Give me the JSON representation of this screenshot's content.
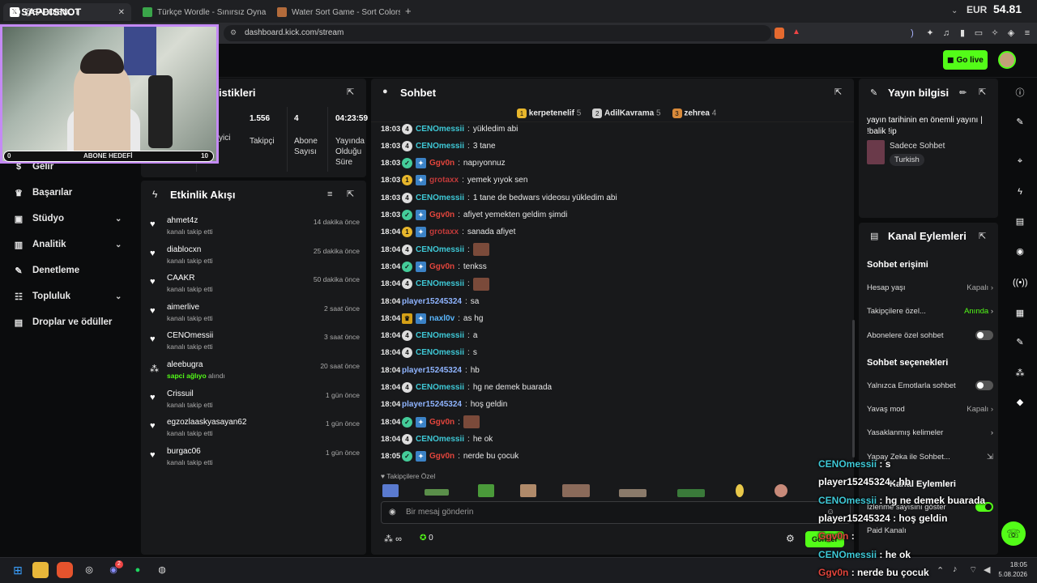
{
  "browser": {
    "tabs": [
      {
        "label": "@SAPDISNOT"
      },
      {
        "label": "Türkçe Wordle - Sınırsız Oyna"
      },
      {
        "label": "Water Sort Game - Sort Colors Online"
      }
    ],
    "new_tab": "+",
    "url": "dashboard.kick.com/stream",
    "currency": "EUR",
    "price": "54.81"
  },
  "topnav": {
    "go_live": "Go live"
  },
  "overlay": {
    "handle": "@SAPDISNOT",
    "sub_goal_label": "ABONE HEDEFİ",
    "sub_goal_current": "0",
    "sub_goal_target": "10"
  },
  "sidebar": {
    "items": [
      {
        "label": "Gelir",
        "icon": "money-icon"
      },
      {
        "label": "Başarılar",
        "icon": "trophy-icon"
      },
      {
        "label": "Stüdyo",
        "icon": "studio-icon"
      },
      {
        "label": "Analitik",
        "icon": "chart-icon"
      },
      {
        "label": "Denetleme",
        "icon": "wrench-icon"
      },
      {
        "label": "Topluluk",
        "icon": "community-icon"
      },
      {
        "label": "Droplar ve ödüller",
        "icon": "gift-icon"
      }
    ]
  },
  "stats": {
    "title_fragment": "istikleri",
    "partial_label": "yici",
    "items": [
      {
        "value": "1.556",
        "label": "Takipçi"
      },
      {
        "value": "4",
        "label": "Abone Sayısı"
      },
      {
        "value": "04:23:59",
        "label": "Yayında Olduğu Süre"
      }
    ]
  },
  "activity": {
    "title": "Etkinlik Akışı",
    "items": [
      {
        "name": "ahmet4z",
        "sub": "kanalı takip etti",
        "time": "14 dakika önce"
      },
      {
        "name": "diablocxn",
        "sub": "kanalı takip etti",
        "time": "25 dakika önce"
      },
      {
        "name": "CAAKR",
        "sub": "kanalı takip etti",
        "time": "50 dakika önce"
      },
      {
        "name": "aimerlive",
        "sub": "kanalı takip etti",
        "time": "2 saat önce"
      },
      {
        "name": "CENOmessii",
        "sub": "kanalı takip etti",
        "time": "3 saat önce"
      },
      {
        "name": "aleebugra",
        "sub_highlight": "sapci ağlıyo",
        "sub": "alındı",
        "time": "20 saat önce"
      },
      {
        "name": "Crissuil",
        "sub": "kanalı takip etti",
        "time": "1 gün önce"
      },
      {
        "name": "egzozlaaskyasayan62",
        "sub": "kanalı takip etti",
        "time": "1 gün önce"
      },
      {
        "name": "burgac06",
        "sub": "kanalı takip etti",
        "time": "1 gün önce"
      }
    ]
  },
  "chat": {
    "title": "Sohbet",
    "top_gifters": [
      {
        "rank": "1",
        "name": "kerpetenelif",
        "count": "5"
      },
      {
        "rank": "2",
        "name": "AdilKavrama",
        "count": "5"
      },
      {
        "rank": "3",
        "name": "zehrea",
        "count": "4"
      }
    ],
    "messages": [
      {
        "time": "18:03",
        "user": "CENOmessii",
        "color": "#3ec8d6",
        "badges": [
          "sub"
        ],
        "text": "yükledim abi"
      },
      {
        "time": "18:03",
        "user": "CENOmessii",
        "color": "#3ec8d6",
        "badges": [
          "sub"
        ],
        "text": "3 tane"
      },
      {
        "time": "18:03",
        "user": "Ggv0n",
        "color": "#e2453c",
        "badges": [
          "verif",
          "vip"
        ],
        "text": "napıyonnuz"
      },
      {
        "time": "18:03",
        "user": "grotaxx",
        "color": "#c23a3a",
        "badges": [
          "og",
          "vip"
        ],
        "text": "yemek yıyok sen"
      },
      {
        "time": "18:03",
        "user": "CENOmessii",
        "color": "#3ec8d6",
        "badges": [
          "sub"
        ],
        "text": "1 tane de bedwars videosu yükledim abi"
      },
      {
        "time": "18:03",
        "user": "Ggv0n",
        "color": "#e2453c",
        "badges": [
          "verif",
          "vip"
        ],
        "text": "afiyet yemekten geldim şimdi"
      },
      {
        "time": "18:04",
        "user": "grotaxx",
        "color": "#c23a3a",
        "badges": [
          "og",
          "vip"
        ],
        "text": "sanada afiyet"
      },
      {
        "time": "18:04",
        "user": "CENOmessii",
        "color": "#3ec8d6",
        "badges": [
          "sub"
        ],
        "text": "",
        "emote": true
      },
      {
        "time": "18:04",
        "user": "Ggv0n",
        "color": "#e2453c",
        "badges": [
          "verif",
          "vip"
        ],
        "text": "tenkss"
      },
      {
        "time": "18:04",
        "user": "CENOmessii",
        "color": "#3ec8d6",
        "badges": [
          "sub"
        ],
        "text": "",
        "emote": true
      },
      {
        "time": "18:04",
        "user": "player15245324",
        "color": "#8fb4ff",
        "badges": [],
        "text": "sa"
      },
      {
        "time": "18:04",
        "user": "naxl0v",
        "color": "#5ab7ff",
        "badges": [
          "crown",
          "vip"
        ],
        "text": "as hg"
      },
      {
        "time": "18:04",
        "user": "CENOmessii",
        "color": "#3ec8d6",
        "badges": [
          "sub"
        ],
        "text": "a"
      },
      {
        "time": "18:04",
        "user": "CENOmessii",
        "color": "#3ec8d6",
        "badges": [
          "sub"
        ],
        "text": "s"
      },
      {
        "time": "18:04",
        "user": "player15245324",
        "color": "#8fb4ff",
        "badges": [],
        "text": "hb"
      },
      {
        "time": "18:04",
        "user": "CENOmessii",
        "color": "#3ec8d6",
        "badges": [
          "sub"
        ],
        "text": "hg ne demek buarada"
      },
      {
        "time": "18:04",
        "user": "player15245324",
        "color": "#8fb4ff",
        "badges": [],
        "text": "hoş geldin"
      },
      {
        "time": "18:04",
        "user": "Ggv0n",
        "color": "#e2453c",
        "badges": [
          "verif",
          "vip"
        ],
        "text": "",
        "emote": true
      },
      {
        "time": "18:04",
        "user": "CENOmessii",
        "color": "#3ec8d6",
        "badges": [
          "sub"
        ],
        "text": "he ok"
      },
      {
        "time": "18:05",
        "user": "Ggv0n",
        "color": "#e2453c",
        "badges": [
          "verif",
          "vip"
        ],
        "text": "nerde bu çocuk"
      }
    ],
    "emote_section_label": "Takipçilere Özel",
    "input_placeholder": "Bir mesaj gönderin",
    "infinity": "∞",
    "points": "0",
    "send_label": "Gönder"
  },
  "stream_info": {
    "title": "Yayın bilgisi",
    "stream_title": "yayın tarihinin en önemli yayını | !balik !ip",
    "category": "Sadece Sohbet",
    "tag": "Turkish"
  },
  "channel_actions": {
    "title": "Kanal Eylemleri",
    "chat_access_title": "Sohbet erişimi",
    "rows": [
      {
        "label": "Hesap yaşı",
        "value": "Kapalı"
      },
      {
        "label": "Takipçilere özel...",
        "value": "Anında"
      }
    ],
    "sub_only": "Abonelere özel sohbet",
    "chat_options_title": "Sohbet seçenekleri",
    "emote_only": "Yalnızca Emotlarla sohbet",
    "slow_mode": "Yavaş mod",
    "slow_value": "Kapalı",
    "banned_words": "Yasaklanmış kelimeler",
    "ai_chat": "Yapay Zeka ile Sohbet...",
    "more_title": "Kanal Eylemleri",
    "viewer_count": "İzlenme sayısını göster",
    "paid": "Paid Kanalı"
  },
  "overlay_chat": [
    {
      "user": "CENOmessii",
      "text": ": s",
      "color": "#3ec8d6"
    },
    {
      "user": "player15245324",
      "text": ": hb",
      "color": "#ffffff"
    },
    {
      "user": "CENOmessii",
      "text": ": hg ne demek buarada",
      "color": "#3ec8d6"
    },
    {
      "user": "player15245324",
      "text": ": hoş geldin",
      "color": "#ffffff"
    },
    {
      "user": "Ggv0n",
      "text": ":",
      "color": "#e2453c"
    },
    {
      "user": "CENOmessii",
      "text": ": he ok",
      "color": "#3ec8d6"
    },
    {
      "user": "Ggv0n",
      "text": ": nerde bu çocuk",
      "color": "#e2453c"
    }
  ],
  "taskbar": {
    "time": "18:05",
    "date": "5.08.2026",
    "steam_badge": "2"
  },
  "colors": {
    "accent": "#53fc18",
    "panel": "#18191b",
    "bg": "#0b0c0d",
    "frame": "#c48af5"
  }
}
